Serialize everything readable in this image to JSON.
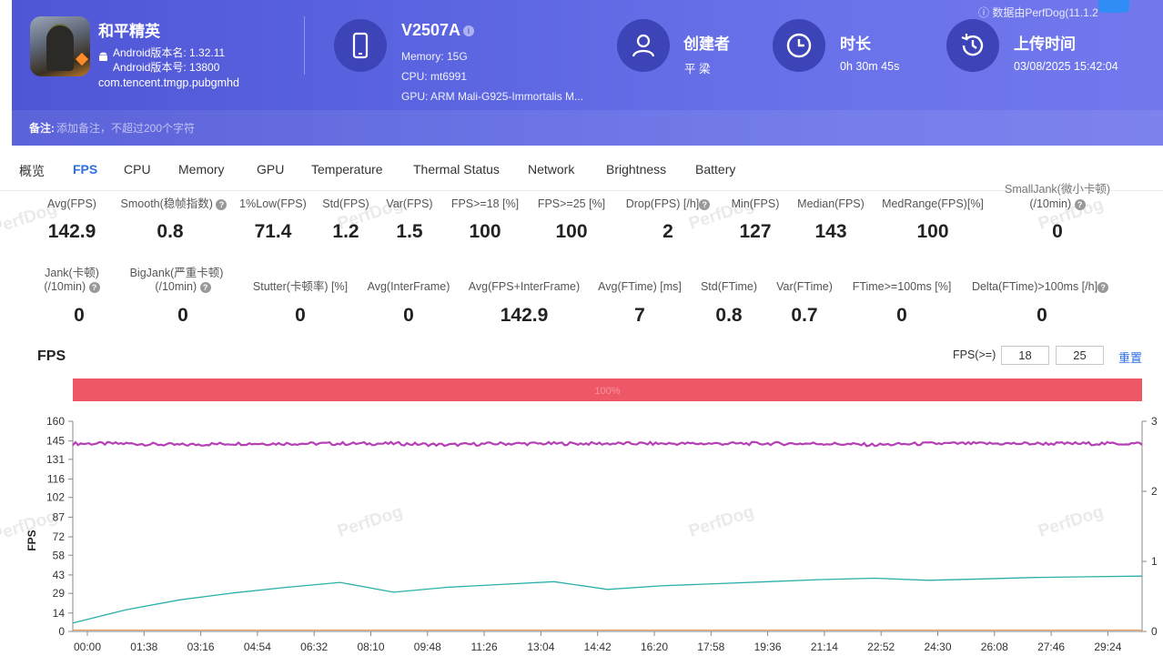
{
  "app": {
    "name": "和平精英",
    "version_name": "Android版本名: 1.32.11",
    "version_code": "Android版本号: 13800",
    "package": "com.tencent.tmgp.pubgmhd"
  },
  "device": {
    "name": "V2507A",
    "memory": "Memory: 15G",
    "cpu": "CPU: mt6991",
    "gpu": "GPU: ARM Mali-G925-Immortalis M..."
  },
  "creator": {
    "title": "创建者",
    "value": "平 梁"
  },
  "duration": {
    "title": "时长",
    "value": "0h 30m 45s"
  },
  "upload": {
    "title": "上传时间",
    "value": "03/08/2025 15:42:04"
  },
  "source_note": "数据由PerfDog(11.1.2",
  "notes": {
    "label": "备注:",
    "placeholder": "添加备注，不超过200个字符"
  },
  "tabs": [
    {
      "label": "概览",
      "active": false
    },
    {
      "label": "FPS",
      "active": true
    },
    {
      "label": "CPU",
      "active": false
    },
    {
      "label": "Memory",
      "active": false
    },
    {
      "label": "GPU",
      "active": false
    },
    {
      "label": "Temperature",
      "active": false
    },
    {
      "label": "Thermal Status",
      "active": false
    },
    {
      "label": "Network",
      "active": false
    },
    {
      "label": "Brightness",
      "active": false
    },
    {
      "label": "Battery",
      "active": false
    }
  ],
  "metrics_row1": [
    {
      "label": "Avg(FPS)",
      "value": "142.9",
      "help": false
    },
    {
      "label": "Smooth(稳帧指数)",
      "value": "0.8",
      "help": true
    },
    {
      "label": "1%Low(FPS)",
      "value": "71.4",
      "help": false
    },
    {
      "label": "Std(FPS)",
      "value": "1.2",
      "help": false
    },
    {
      "label": "Var(FPS)",
      "value": "1.5",
      "help": false
    },
    {
      "label": "FPS>=18 [%]",
      "value": "100",
      "help": false
    },
    {
      "label": "FPS>=25 [%]",
      "value": "100",
      "help": false
    },
    {
      "label": "Drop(FPS) [/h]",
      "value": "2",
      "help": true
    },
    {
      "label": "Min(FPS)",
      "value": "127",
      "help": false
    },
    {
      "label": "Median(FPS)",
      "value": "143",
      "help": false
    },
    {
      "label": "MedRange(FPS)[%]",
      "value": "100",
      "help": false
    },
    {
      "label": "SmallJank(微小卡顿)",
      "label2": "(/10min)",
      "value": "0",
      "help": true
    }
  ],
  "metrics_row2": [
    {
      "label": "Jank(卡顿)",
      "label2": "(/10min)",
      "value": "0",
      "help": true
    },
    {
      "label": "BigJank(严重卡顿)",
      "label2": "(/10min)",
      "value": "0",
      "help": true
    },
    {
      "label": "Stutter(卡顿率) [%]",
      "value": "0",
      "help": false
    },
    {
      "label": "Avg(InterFrame)",
      "value": "0",
      "help": false
    },
    {
      "label": "Avg(FPS+InterFrame)",
      "value": "142.9",
      "help": false
    },
    {
      "label": "Avg(FTime) [ms]",
      "value": "7",
      "help": false
    },
    {
      "label": "Std(FTime)",
      "value": "0.8",
      "help": false
    },
    {
      "label": "Var(FTime)",
      "value": "0.7",
      "help": false
    },
    {
      "label": "FTime>=100ms [%]",
      "value": "0",
      "help": false
    },
    {
      "label": "Delta(FTime)>100ms [/h]",
      "value": "0",
      "help": true
    }
  ],
  "watermark": "PerfDog",
  "chart_header": {
    "title": "FPS",
    "filter_label": "FPS(>=)",
    "filter_a": "18",
    "filter_b": "25",
    "reset": "重置"
  },
  "chart_data": {
    "type": "line",
    "ylabel": "FPS",
    "ylim": [
      0,
      160
    ],
    "yticks": [
      "0",
      "14",
      "29",
      "43",
      "58",
      "72",
      "87",
      "102",
      "116",
      "131",
      "145",
      "160"
    ],
    "y2ticks": [
      "0",
      "1",
      "2",
      "3"
    ],
    "xticks": [
      "00:00",
      "01:38",
      "03:16",
      "04:54",
      "06:32",
      "08:10",
      "09:48",
      "11:26",
      "13:04",
      "14:42",
      "16:20",
      "17:58",
      "19:36",
      "21:14",
      "22:52",
      "24:30",
      "26:08",
      "27:46",
      "29:24"
    ],
    "band": {
      "color": "#ee5866",
      "label": "100%"
    },
    "series": [
      {
        "color": "#b53fb5",
        "values": [
          143,
          143,
          142,
          143,
          143,
          143,
          143,
          142,
          143,
          143,
          143,
          143,
          143,
          143,
          143,
          142,
          143,
          143,
          143,
          143,
          143
        ]
      },
      {
        "color": "#2ab0aa",
        "values": [
          0.12,
          0.31,
          0.45,
          0.55,
          0.63,
          0.7,
          0.56,
          0.63,
          0.67,
          0.71,
          0.6,
          0.65,
          0.68,
          0.71,
          0.74,
          0.76,
          0.73,
          0.75,
          0.77,
          0.78,
          0.79
        ]
      },
      {
        "color": "#e8a060",
        "values": [
          0.02,
          0.02,
          0.02,
          0.02,
          0.02,
          0.02,
          0.02,
          0.02,
          0.02,
          0.02,
          0.02,
          0.02,
          0.02,
          0.02,
          0.02,
          0.02,
          0.02,
          0.02,
          0.02,
          0.02,
          0.02
        ]
      }
    ]
  }
}
